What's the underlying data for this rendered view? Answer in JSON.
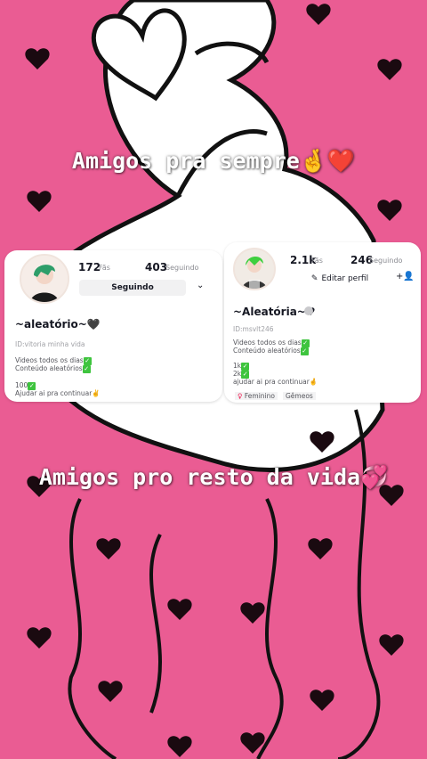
{
  "captions": {
    "top": "Amigos pra sempre",
    "top_emoji": "🤞❤️",
    "bottom": "Amigos pro resto da vida",
    "bottom_emoji": "💞"
  },
  "left_profile": {
    "fans_count": "172",
    "fans_label": "Fãs",
    "following_count": "403",
    "following_label": "Seguindo",
    "follow_button": "Seguindo",
    "name": "~aleatório~🖤",
    "id_line": "ID:vitoria minha vida",
    "bio_line1": "Videos todos os dias",
    "bio_line2": "Conteúdo aleatórios",
    "bio_line3": "100",
    "bio_line4": "Ajudar ai pra continuar✌️"
  },
  "right_profile": {
    "fans_count": "2.1k",
    "fans_label": "Fãs",
    "following_count": "246",
    "following_label": "Seguindo",
    "edit_button": "Editar perfil",
    "name": "~Aleatória~♥",
    "id_line": "ID:msvlt246",
    "bio_line1": "Videos todos os dias",
    "bio_line2": "Conteúdo aleatórios",
    "bio_line3": "1k",
    "bio_line4": "2k",
    "bio_line5": "ajudar ai pra continuar🤞",
    "tag_gender": "Feminino",
    "tag_sign": "Gêmeos"
  },
  "colors": {
    "background": "#ea5c93",
    "heart": "#1a0a10",
    "check": "#3ec43e"
  }
}
